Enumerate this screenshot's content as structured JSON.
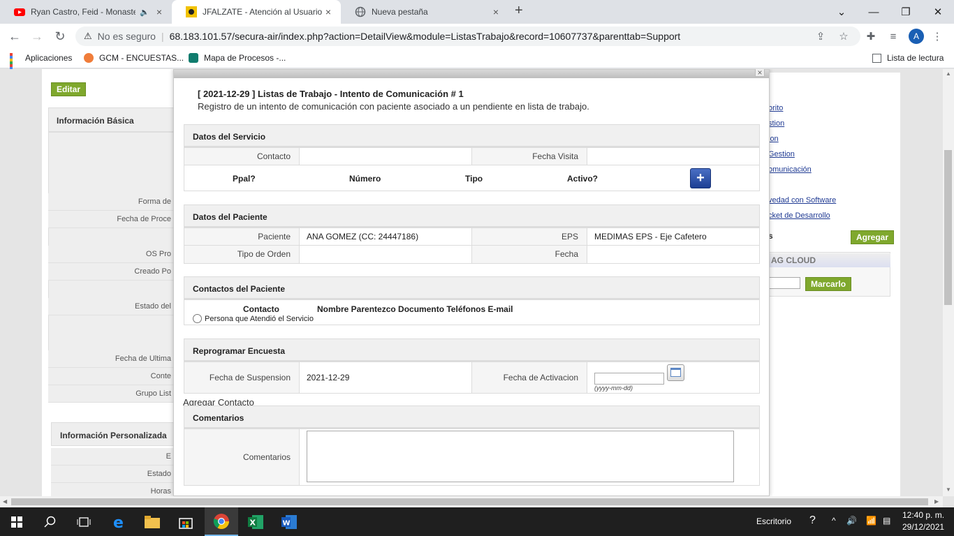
{
  "browser": {
    "tabs": [
      {
        "title": "Ryan Castro, Feid - Monaster",
        "audio": "speaker-icon",
        "close": "×"
      },
      {
        "title": "JFALZATE - Atención al Usuario -",
        "close": "×"
      },
      {
        "title": "Nueva pestaña",
        "close": "×"
      }
    ],
    "new_tab": "+",
    "window_controls": {
      "minimize": "—",
      "maximize": "❐",
      "close": "✕",
      "tab_search": "⌄"
    },
    "address": {
      "security_label": "No es seguro",
      "url": "68.183.101.57/secura-air/index.php?action=DetailView&module=ListasTrabajo&record=10607737&parenttab=Support"
    },
    "profile_initial": "A",
    "bookmarks": [
      {
        "label": "Aplicaciones"
      },
      {
        "label": "GCM - ENCUESTAS..."
      },
      {
        "label": "Mapa de Procesos -..."
      }
    ],
    "reading_list": "Lista de lectura"
  },
  "background": {
    "edit_button": "Editar",
    "basic_info_title": "Información Básica",
    "left_labels": [
      "Forma de",
      "Fecha de Proce",
      "OS Pro",
      "Creado Po",
      "Estado del",
      "Fecha de Ultima",
      "Conte",
      "Grupo List"
    ],
    "custom_info_title": "Información Personalizada",
    "custom_labels": [
      "E",
      "Estado",
      "Horas"
    ],
    "right_links": [
      "orito",
      "stion",
      "ion",
      "Gestion",
      "omunicación",
      "vedad con Software",
      "cket de Desarrollo"
    ],
    "right_section_letter": "s",
    "add_button": "Agregar",
    "tag_cloud_title": "AG CLOUD",
    "mark_button": "Marcarlo"
  },
  "modal": {
    "close": "×",
    "title": "[ 2021-12-29 ] Listas de Trabajo - Intento de Comunicación # 1",
    "subtitle": "Registro de un intento de comunicación con paciente asociado a un pendiente en lista de trabajo.",
    "servicio": {
      "heading": "Datos del Servicio",
      "contacto_label": "Contacto",
      "contacto_value": "",
      "fecha_visita_label": "Fecha Visita",
      "fecha_visita_value": "",
      "phone_headers": {
        "ppal": "Ppal?",
        "numero": "Número",
        "tipo": "Tipo",
        "activo": "Activo?"
      },
      "add_phone": "+"
    },
    "paciente": {
      "heading": "Datos del Paciente",
      "paciente_label": "Paciente",
      "paciente_value": "ANA GOMEZ (CC: 24447186)",
      "eps_label": "EPS",
      "eps_value": "MEDIMAS EPS - Eje Cafetero",
      "tipo_orden_label": "Tipo de Orden",
      "tipo_orden_value": "",
      "fecha_label": "Fecha",
      "fecha_value": ""
    },
    "contactos": {
      "heading": "Contactos del Paciente",
      "col_contacto": "Contacto",
      "col_rest": "Nombre Parentezco Documento Teléfonos E-mail",
      "radio_label": "Persona que Atendió el Servicio"
    },
    "add_contact": "Agregar Contacto",
    "reprogramar": {
      "heading": "Reprogramar Encuesta",
      "suspension_label": "Fecha de Suspension",
      "suspension_value": "2021-12-29",
      "activacion_label": "Fecha de Activacion",
      "activacion_value": "",
      "date_hint": "(yyyy-mm-dd)"
    },
    "comentarios": {
      "heading": "Comentarios",
      "label": "Comentarios",
      "value": ""
    }
  },
  "taskbar": {
    "desktop_label": "Escritorio",
    "time": "12:40 p. m.",
    "date": "29/12/2021"
  },
  "colors": {
    "accent_green": "#7fa82d",
    "plus_blue": "#1d3f94",
    "link_blue": "#1f3a93"
  }
}
